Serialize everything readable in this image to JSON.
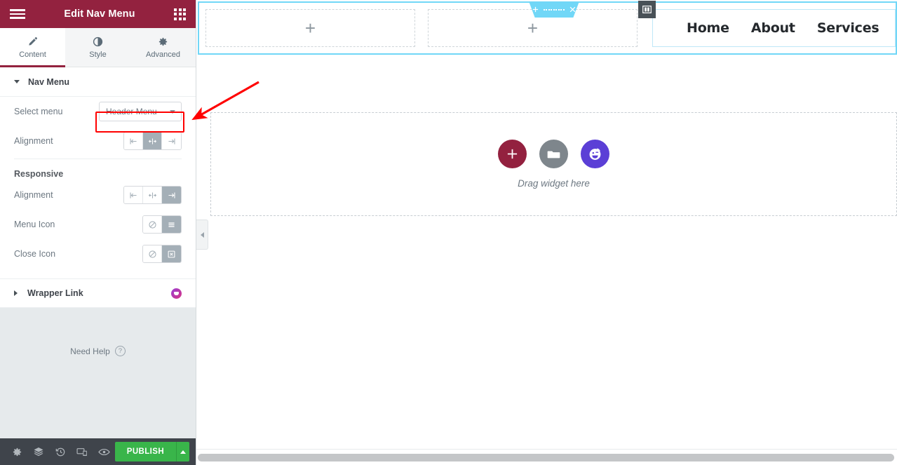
{
  "panel": {
    "header": {
      "title": "Edit Nav Menu",
      "menu_icon": "hamburger-icon",
      "apps_icon": "apps-grid-icon"
    },
    "tabs": [
      {
        "label": "Content",
        "icon": "pencil-icon",
        "active": true
      },
      {
        "label": "Style",
        "icon": "contrast-circle-icon",
        "active": false
      },
      {
        "label": "Advanced",
        "icon": "gear-icon",
        "active": false
      }
    ],
    "sections": [
      {
        "title": "Nav Menu",
        "expanded": true,
        "controls": [
          {
            "label": "Select menu",
            "type": "select",
            "value": "Header Menu",
            "options": [
              "Header Menu"
            ],
            "highlighted": true
          },
          {
            "label": "Alignment",
            "type": "choices",
            "choices": [
              "align-left-icon",
              "align-center-icon",
              "align-right-icon"
            ],
            "selected_index": 1
          }
        ],
        "group": {
          "label": "Responsive",
          "controls": [
            {
              "label": "Alignment",
              "type": "choices",
              "choices": [
                "align-left-icon",
                "align-center-icon",
                "align-right-icon"
              ],
              "selected_index": 2
            },
            {
              "label": "Menu Icon",
              "type": "choices",
              "choices": [
                "none-icon",
                "hamburger-bars-icon"
              ],
              "selected_index": 1
            },
            {
              "label": "Close Icon",
              "type": "choices",
              "choices": [
                "none-icon",
                "close-box-icon"
              ],
              "selected_index": 1
            }
          ]
        }
      },
      {
        "title": "Wrapper Link",
        "expanded": false,
        "pro_badge": true
      }
    ],
    "need_help": {
      "label": "Need Help",
      "icon": "question-mark-icon",
      "glyph": "?"
    },
    "footer": {
      "icons": [
        "gear-icon",
        "layers-icon",
        "history-icon",
        "responsive-mode-icon",
        "preview-eye-icon"
      ],
      "publish_label": "PUBLISH",
      "publish_caret": "caret-up-icon"
    }
  },
  "canvas": {
    "section_toolbar": {
      "add": "plus-icon",
      "drag": "drag-dots-icon",
      "remove": "close-x-icon"
    },
    "column_handle_icon": "column-edit-icon",
    "columns": [
      {
        "type": "empty",
        "add_icon": "plus-icon"
      },
      {
        "type": "empty",
        "add_icon": "plus-icon"
      }
    ],
    "nav_menu": {
      "items": [
        "Home",
        "About",
        "Services"
      ]
    },
    "drop_area": {
      "text": "Drag widget here",
      "buttons": [
        {
          "name": "add-widget-button",
          "icon": "plus-icon",
          "color": "#93213f"
        },
        {
          "name": "add-template-button",
          "icon": "folder-icon",
          "color": "#7e868c"
        },
        {
          "name": "ai-button",
          "icon": "ai-face-icon",
          "color": "#5b3fd6"
        }
      ]
    },
    "collapse_panel_icon": "chevron-left-icon",
    "scrollbar": "horizontal-scrollbar"
  },
  "annotation": {
    "type": "red-arrow",
    "color": "#ff0000",
    "points_to": "select-menu-dropdown"
  },
  "colors": {
    "brand_maroon": "#93223f",
    "publish_green": "#39b54a",
    "section_blue": "#71d7f7",
    "ai_purple": "#5b3fd6",
    "annotation_red": "#ff0000"
  }
}
